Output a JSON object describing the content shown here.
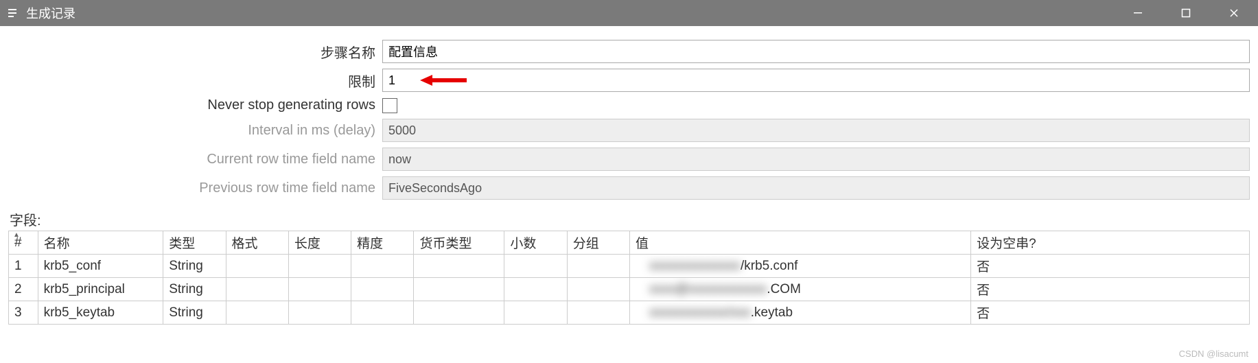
{
  "window": {
    "title": "生成记录"
  },
  "form": {
    "step_name_label": "步骤名称",
    "step_name_value": "配置信息",
    "limit_label": "限制",
    "limit_value": "1",
    "never_stop_label": "Never stop generating rows",
    "never_stop_checked": false,
    "interval_label": "Interval in ms (delay)",
    "interval_value": "5000",
    "current_row_label": "Current row time field name",
    "current_row_value": "now",
    "previous_row_label": "Previous row time field name",
    "previous_row_value": "FiveSecondsAgo"
  },
  "fields": {
    "section_label": "字段:",
    "headers": {
      "index": "#",
      "name": "名称",
      "type": "类型",
      "format": "格式",
      "length": "长度",
      "precision": "精度",
      "currency": "货币类型",
      "decimal": "小数",
      "group": "分组",
      "value": "值",
      "set_null": "设为空串?"
    },
    "rows": [
      {
        "idx": "1",
        "name": "krb5_conf",
        "type": "String",
        "format": "",
        "length": "",
        "precision": "",
        "currency": "",
        "decimal": "",
        "group": "",
        "value_pre": "",
        "value_blur": "xxxxxxxxxxxxxx",
        "value_post": "/krb5.conf",
        "set_null": "否"
      },
      {
        "idx": "2",
        "name": "krb5_principal",
        "type": "String",
        "format": "",
        "length": "",
        "precision": "",
        "currency": "",
        "decimal": "",
        "group": "",
        "value_pre": "",
        "value_blur": "xxxx@xxxxxxxxxxxx",
        "value_post": ".COM",
        "set_null": "否"
      },
      {
        "idx": "3",
        "name": "krb5_keytab",
        "type": "String",
        "format": "",
        "length": "",
        "precision": "",
        "currency": "",
        "decimal": "",
        "group": "",
        "value_pre": "",
        "value_blur": "xxxxxxxxxxxx/xxx",
        "value_post": ".keytab",
        "set_null": "否"
      }
    ]
  },
  "watermark": "CSDN @lisacumt"
}
